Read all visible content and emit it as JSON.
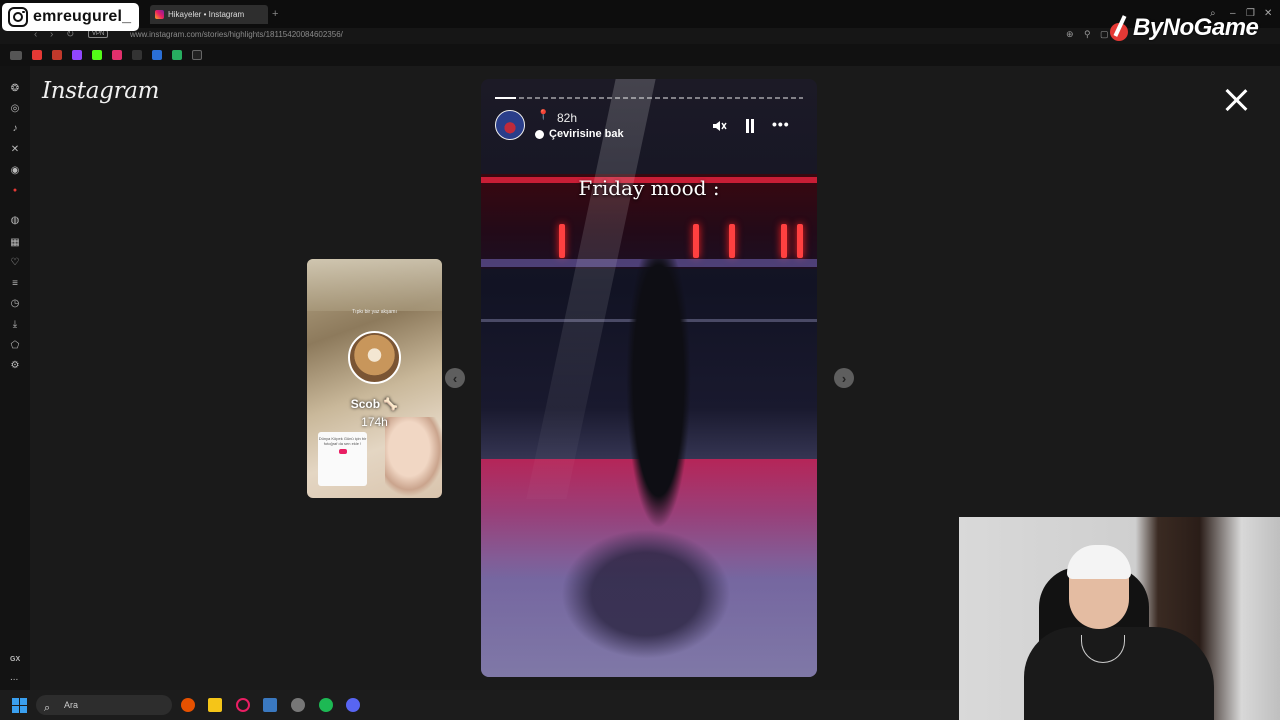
{
  "streamer": {
    "name": "emreugurel_",
    "icon": "instagram-icon"
  },
  "brand": {
    "name": "ByNoGame"
  },
  "browser": {
    "tab_title": "Hikayeler • Instagram",
    "new_tab": "+",
    "url": "www.instagram.com/stories/highlights/18115420084602356/",
    "vpn": "VPN"
  },
  "sidebar": {
    "gx_label": "GX",
    "more_label": "..."
  },
  "page": {
    "logo": "Instagram",
    "close_icon": "close-icon"
  },
  "preview": {
    "hint": "Tıpkı bir yaz akşamı",
    "name": "Scob 🦴",
    "time": "174h",
    "card_text": "Dünya Köpek Günü için bir fotoğraf da sen ekle !"
  },
  "story": {
    "time": "82h",
    "translate": "Çevirisine bak",
    "caption": "Friday mood :",
    "progress_segments": 30,
    "progress_done": 2,
    "more": "•••"
  },
  "taskbar": {
    "search_placeholder": "Ara"
  },
  "colors": {
    "accent_red": "#e53935",
    "background": "#1a1a1a",
    "story_pink": "#e0205a"
  }
}
